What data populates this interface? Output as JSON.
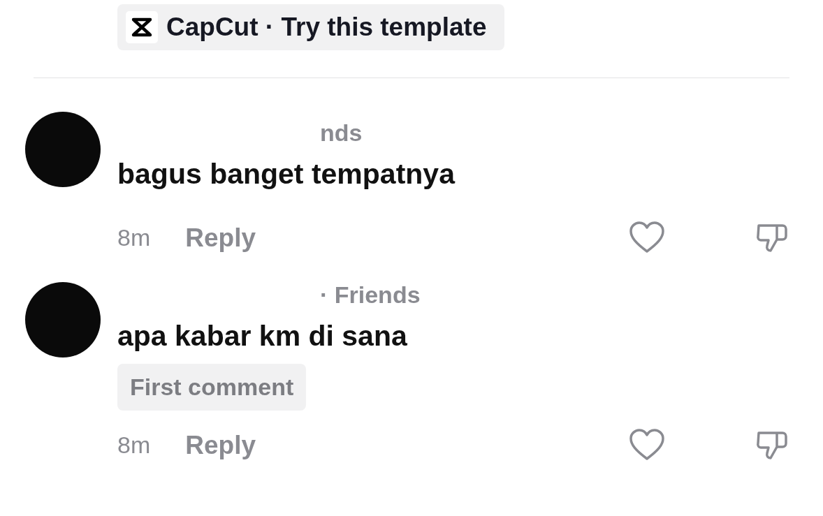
{
  "template_link": {
    "label": "CapCut · Try this template"
  },
  "comments": [
    {
      "author": "nds",
      "text": "bagus banget tempatnya",
      "time": "8m",
      "reply": "Reply"
    },
    {
      "author": "· Friends",
      "text": "apa kabar km di sana",
      "badge": "First comment",
      "time": "8m",
      "reply": "Reply"
    }
  ]
}
